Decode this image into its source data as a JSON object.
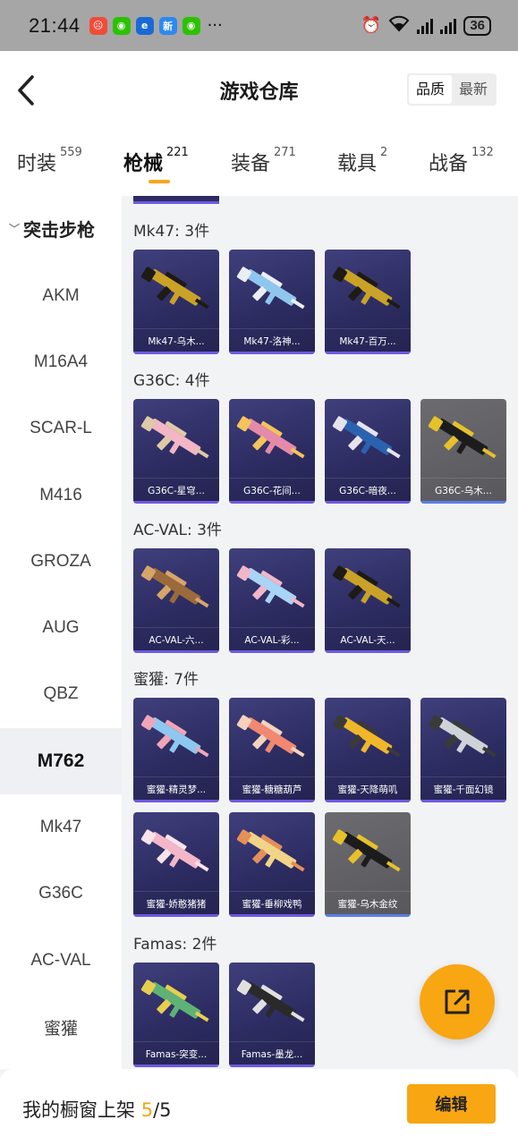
{
  "status_bar": {
    "time": "21:44",
    "apps": [
      {
        "icon": "alert-app-icon",
        "color": "#f04c3a",
        "glyph": "☹"
      },
      {
        "icon": "wechat-icon",
        "color": "#2dc100",
        "glyph": "◉"
      },
      {
        "icon": "browser-app-icon",
        "color": "#1a6ad6",
        "glyph": "e"
      },
      {
        "icon": "news-app-icon",
        "color": "#2d88f0",
        "glyph": "新"
      },
      {
        "icon": "wechat-icon",
        "color": "#2dc100",
        "glyph": "◉"
      }
    ],
    "more": "···",
    "wifi_label": "6",
    "battery": "36"
  },
  "header": {
    "title": "游戏仓库",
    "sort_options": [
      "品质",
      "最新"
    ],
    "sort_active": "品质"
  },
  "tabs": [
    {
      "label": "时装",
      "count": "559"
    },
    {
      "label": "枪械",
      "count": "221"
    },
    {
      "label": "装备",
      "count": "271"
    },
    {
      "label": "载具",
      "count": "2"
    },
    {
      "label": "战备",
      "count": "132"
    }
  ],
  "active_tab": "枪械",
  "sidebar": {
    "group": "突击步枪",
    "items": [
      "AKM",
      "M16A4",
      "SCAR-L",
      "M416",
      "GROZA",
      "AUG",
      "QBZ",
      "M762",
      "Mk47",
      "G36C",
      "AC-VAL",
      "蜜獾"
    ],
    "active": "M762"
  },
  "sections": [
    {
      "title": "Mk47: 3件",
      "cards": [
        "Mk47-乌木...",
        "Mk47-洛神...",
        "Mk47-百万..."
      ]
    },
    {
      "title": "G36C: 4件",
      "cards": [
        "G36C-星穹...",
        "G36C-花间...",
        "G36C-暗夜...",
        "G36C-乌木..."
      ]
    },
    {
      "title": "AC-VAL: 3件",
      "cards": [
        "AC-VAL-六...",
        "AC-VAL-彩...",
        "AC-VAL-天..."
      ]
    },
    {
      "title": "蜜獾: 7件",
      "cards": [
        "蜜獾-精灵梦...",
        "蜜獾-糖糖葫芦",
        "蜜獾-天降萌叽",
        "蜜獾-千面幻镜",
        "蜜獾-娇憨猪猪",
        "蜜獾-垂柳戏鸭",
        "蜜獾-乌木金纹"
      ]
    },
    {
      "title": "Famas: 2件",
      "cards": [
        "Famas-突变...",
        "Famas-墨龙..."
      ]
    }
  ],
  "bottom": {
    "text": "我的橱窗上架",
    "count": "5",
    "separator": "/",
    "total": "5",
    "edit_label": "编辑"
  },
  "colors": {
    "accent": "#f8a612",
    "card_bg": "#2d2c62",
    "card_stripe": "#6f59e0"
  }
}
